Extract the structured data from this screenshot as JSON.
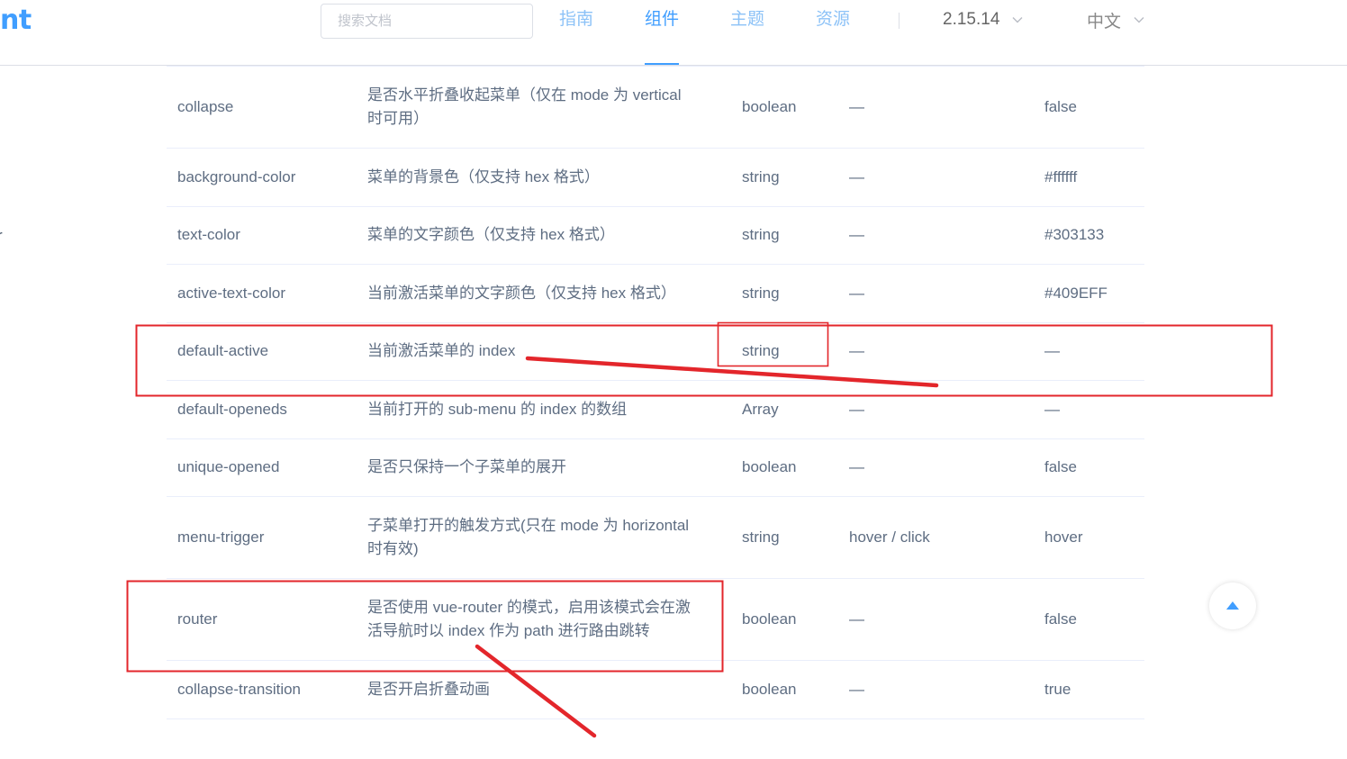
{
  "header": {
    "logo_text": "nt",
    "search": {
      "placeholder": "搜索文档",
      "value": ""
    },
    "nav": [
      {
        "label": "指南",
        "active": false
      },
      {
        "label": "组件",
        "active": true
      },
      {
        "label": "主题",
        "active": false
      },
      {
        "label": "资源",
        "active": false
      }
    ],
    "version": {
      "label": "2.15.14",
      "icon": "chevron-down-icon"
    },
    "language": {
      "label": "中文",
      "icon": "chevron-down-icon"
    }
  },
  "sidebar": {
    "partial_item_label": "r"
  },
  "attributes_table": {
    "rows": [
      {
        "name": "collapse",
        "desc": "是否水平折叠收起菜单（仅在 mode 为 vertical\n时可用）",
        "type": "boolean",
        "accepted": "—",
        "default": "false"
      },
      {
        "name": "background-color",
        "desc": "菜单的背景色（仅支持 hex 格式）",
        "type": "string",
        "accepted": "—",
        "default": "#ffffff"
      },
      {
        "name": "text-color",
        "desc": "菜单的文字颜色（仅支持 hex 格式）",
        "type": "string",
        "accepted": "—",
        "default": "#303133"
      },
      {
        "name": "active-text-color",
        "desc": "当前激活菜单的文字颜色（仅支持 hex 格式）",
        "type": "string",
        "accepted": "—",
        "default": "#409EFF"
      },
      {
        "name": "default-active",
        "desc": "当前激活菜单的 index",
        "type": "string",
        "accepted": "—",
        "default": "—"
      },
      {
        "name": "default-openeds",
        "desc": "当前打开的 sub-menu 的 index 的数组",
        "type": "Array",
        "accepted": "—",
        "default": "—"
      },
      {
        "name": "unique-opened",
        "desc": "是否只保持一个子菜单的展开",
        "type": "boolean",
        "accepted": "—",
        "default": "false"
      },
      {
        "name": "menu-trigger",
        "desc": "子菜单打开的触发方式(只在 mode 为 horizontal\n时有效)",
        "type": "string",
        "accepted": "hover / click",
        "default": "hover"
      },
      {
        "name": "router",
        "desc": "是否使用 vue-router 的模式，启用该模式会在激\n活导航时以 index 作为 path 进行路由跳转",
        "type": "boolean",
        "accepted": "—",
        "default": "false"
      },
      {
        "name": "collapse-transition",
        "desc": "是否开启折叠动画",
        "type": "boolean",
        "accepted": "—",
        "default": "true"
      }
    ]
  },
  "back_to_top": {
    "icon": "caret-up-icon"
  },
  "colors": {
    "accent": "#409EFF",
    "nav_inactive": "#8cc2f7",
    "table_text": "#5e6d82",
    "table_border": "#eaeefb",
    "annotation": "#e3262b"
  }
}
